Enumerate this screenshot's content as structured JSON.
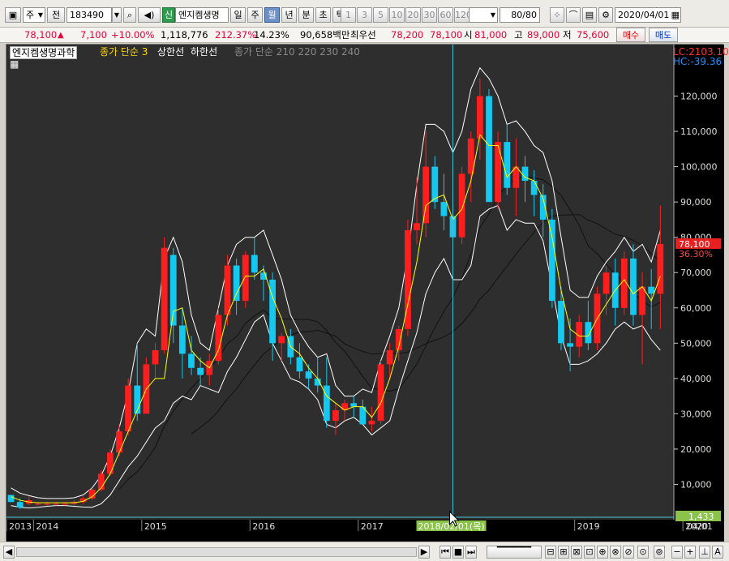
{
  "toolbar": {
    "period_code": "주",
    "prev_label": "전",
    "stock_code": "183490",
    "badge_new": "신",
    "stock_name": "엔지켐생명",
    "period_tabs": [
      "일",
      "주",
      "월",
      "년",
      "분",
      "초",
      "틱"
    ],
    "active_period": "월",
    "number_tabs": [
      "1",
      "3",
      "5",
      "10",
      "20",
      "30",
      "60",
      "120"
    ],
    "count_display": "80/80",
    "date_value": "2020/04/01"
  },
  "quote": {
    "price": "78,100",
    "change_arrow": "▲",
    "change": "7,100",
    "change_pct": "+10.00%",
    "volume": "1,118,776",
    "vol_ratio": "212.37%",
    "turnover": "14.23%",
    "amount": "90,658백만",
    "min_quote_label": "최우선",
    "best_ask": "78,200",
    "best_bid": "78,100",
    "open_label": "시",
    "open": "81,000",
    "high_label": "고",
    "high": "89,000",
    "low_label": "저",
    "low": "75,600",
    "buy_label": "매수",
    "sell_label": "매도"
  },
  "legend": {
    "name": "엔지켐생명과학",
    "ma_label": "종가 단순 3",
    "upper_label": "상한선",
    "lower_label": "하한선",
    "ma_long_label": "종가 단순 210 220 230 240"
  },
  "readouts": {
    "lc": "LC:2103.10",
    "hc": "HC:-39.36",
    "last_price": "78,100",
    "last_pct": "36.30%",
    "cursor_value": "1,433",
    "cursor_date": "2018/02/01(목)",
    "x_end": "04/01"
  },
  "colors": {
    "up": "#ff1e1e",
    "down": "#14c8f0",
    "ma": "#ffff00",
    "band": "#ffffff",
    "long_ma": "#000000",
    "cursor": "#47c3d9"
  },
  "chart_data": {
    "type": "candlestick",
    "interval": "monthly",
    "ylim": [
      0,
      130000
    ],
    "y_ticks": [
      10000,
      20000,
      30000,
      40000,
      50000,
      60000,
      70000,
      80000,
      90000,
      100000,
      110000,
      120000
    ],
    "y_tick_labels": [
      "10,000",
      "20,000",
      "30,000",
      "40,000",
      "50,000",
      "60,000",
      "70,000",
      "80,000",
      "90,000",
      "100,000",
      "110,000",
      "120,000"
    ],
    "x_year_labels": [
      "2013",
      "2014",
      "2015",
      "2016",
      "2017",
      "2019",
      "2020"
    ],
    "x_year_start_index": [
      0,
      3,
      15,
      27,
      39,
      63,
      75
    ],
    "candles": [
      [
        7000,
        7000,
        5000,
        5000
      ],
      [
        5000,
        6000,
        3000,
        3500
      ],
      [
        4500,
        6500,
        4000,
        5500
      ],
      [
        4500,
        5000,
        4000,
        4500
      ],
      [
        4500,
        5000,
        4000,
        4500
      ],
      [
        4500,
        5000,
        4000,
        4500
      ],
      [
        4500,
        5000,
        4000,
        4500
      ],
      [
        4500,
        5500,
        4000,
        5000
      ],
      [
        5000,
        6500,
        4500,
        6000
      ],
      [
        6000,
        9000,
        5500,
        8500
      ],
      [
        8500,
        14000,
        8000,
        13000
      ],
      [
        13000,
        20000,
        12500,
        19000
      ],
      [
        19000,
        27000,
        18000,
        25000
      ],
      [
        25000,
        40000,
        24000,
        38000
      ],
      [
        38000,
        50000,
        28000,
        30000
      ],
      [
        30000,
        46000,
        30000,
        44000
      ],
      [
        44000,
        50000,
        40000,
        48000
      ],
      [
        48000,
        80000,
        47000,
        77000
      ],
      [
        75000,
        77000,
        50000,
        55000
      ],
      [
        55000,
        60000,
        40000,
        47000
      ],
      [
        47000,
        52000,
        41000,
        43000
      ],
      [
        43000,
        46000,
        38000,
        41000
      ],
      [
        41000,
        47000,
        38000,
        45000
      ],
      [
        45000,
        60000,
        44000,
        58000
      ],
      [
        58000,
        75000,
        55000,
        72000
      ],
      [
        72000,
        74000,
        58000,
        62000
      ],
      [
        62000,
        76000,
        60000,
        75000
      ],
      [
        75000,
        80000,
        68000,
        70000
      ],
      [
        70000,
        72000,
        62000,
        68000
      ],
      [
        68000,
        70000,
        45000,
        50000
      ],
      [
        50000,
        53000,
        45000,
        52000
      ],
      [
        52000,
        54000,
        44000,
        46000
      ],
      [
        46000,
        50000,
        40000,
        42000
      ],
      [
        42000,
        44000,
        37000,
        40000
      ],
      [
        40000,
        46000,
        36000,
        38000
      ],
      [
        38000,
        46000,
        26000,
        28000
      ],
      [
        28000,
        33000,
        24000,
        31000
      ],
      [
        31000,
        34000,
        28000,
        33000
      ],
      [
        33000,
        35000,
        29000,
        32000
      ],
      [
        32000,
        34000,
        27000,
        27000
      ],
      [
        27000,
        32000,
        25000,
        28000
      ],
      [
        28000,
        45000,
        27000,
        44000
      ],
      [
        44000,
        50000,
        40000,
        48000
      ],
      [
        48000,
        55000,
        45000,
        54000
      ],
      [
        54000,
        85000,
        52000,
        82000
      ],
      [
        82000,
        97000,
        78000,
        84000
      ],
      [
        84000,
        110000,
        80000,
        100000
      ],
      [
        100000,
        103000,
        88000,
        90000
      ],
      [
        90000,
        98000,
        82000,
        86000
      ],
      [
        86000,
        90000,
        78000,
        80000
      ],
      [
        80000,
        100000,
        78000,
        98000
      ],
      [
        98000,
        110000,
        90000,
        108000
      ],
      [
        108000,
        125000,
        102000,
        120000
      ],
      [
        120000,
        122000,
        95000,
        90000
      ],
      [
        90000,
        110000,
        88000,
        107000
      ],
      [
        107000,
        112000,
        92000,
        94000
      ],
      [
        94000,
        108000,
        86000,
        100000
      ],
      [
        100000,
        103000,
        90000,
        96000
      ],
      [
        96000,
        99000,
        86000,
        92000
      ],
      [
        92000,
        95000,
        80000,
        85000
      ],
      [
        85000,
        88000,
        60000,
        62000
      ],
      [
        62000,
        66000,
        48000,
        50000
      ],
      [
        50000,
        57000,
        42000,
        49000
      ],
      [
        49000,
        58000,
        46000,
        56000
      ],
      [
        56000,
        62000,
        48000,
        50000
      ],
      [
        50000,
        66000,
        48000,
        64000
      ],
      [
        64000,
        72000,
        58000,
        70000
      ],
      [
        70000,
        74000,
        55000,
        60000
      ],
      [
        60000,
        76000,
        58000,
        74000
      ],
      [
        74000,
        78000,
        55000,
        58000
      ],
      [
        58000,
        70000,
        44000,
        66000
      ],
      [
        66000,
        71000,
        54000,
        64000
      ],
      [
        64000,
        89000,
        54000,
        78100
      ]
    ],
    "ma3": [
      6500,
      5500,
      5000,
      4800,
      4800,
      4800,
      4800,
      4800,
      5200,
      6500,
      9000,
      13000,
      19000,
      25000,
      31000,
      37000,
      40000,
      40000,
      59000,
      60000,
      48000,
      45000,
      43000,
      48000,
      58000,
      64000,
      69000,
      69000,
      71000,
      63000,
      57000,
      49000,
      47000,
      43000,
      40000,
      35000,
      33000,
      31000,
      32000,
      32000,
      29000,
      33000,
      40000,
      49000,
      61000,
      73000,
      89000,
      91000,
      92000,
      85000,
      88000,
      96000,
      109000,
      106000,
      106000,
      97000,
      100000,
      97000,
      96000,
      91000,
      80000,
      65000,
      54000,
      52000,
      52000,
      57000,
      61000,
      65000,
      68000,
      64000,
      66000,
      62000,
      69000
    ],
    "band_upper": [
      9000,
      7500,
      6800,
      6200,
      6000,
      6000,
      6000,
      6200,
      7000,
      9000,
      12500,
      18000,
      26000,
      36000,
      50000,
      54000,
      52000,
      74000,
      80000,
      73000,
      58000,
      50000,
      48000,
      60000,
      72000,
      78000,
      80000,
      80000,
      82000,
      75000,
      68000,
      58000,
      53000,
      49000,
      46000,
      47000,
      38000,
      35000,
      35000,
      37000,
      36000,
      45000,
      52000,
      60000,
      75000,
      95000,
      112000,
      112000,
      110000,
      104000,
      110000,
      122000,
      128000,
      125000,
      120000,
      112000,
      113000,
      110000,
      106000,
      104000,
      96000,
      80000,
      65000,
      63000,
      63000,
      69000,
      73000,
      76000,
      80000,
      76000,
      78000,
      73000,
      82000
    ],
    "band_lower": [
      4000,
      3500,
      3300,
      3500,
      3800,
      4000,
      4000,
      3800,
      3600,
      3500,
      4500,
      7000,
      11000,
      15000,
      18000,
      22000,
      26000,
      28000,
      33000,
      35000,
      34000,
      38000,
      37000,
      36000,
      42000,
      46000,
      51000,
      56000,
      58000,
      50000,
      45000,
      40000,
      39000,
      37000,
      34000,
      27000,
      26000,
      28000,
      29000,
      27000,
      24000,
      26000,
      28000,
      37000,
      45000,
      53000,
      64000,
      70000,
      74000,
      68000,
      68000,
      72000,
      86000,
      88000,
      89000,
      82000,
      85000,
      84000,
      84000,
      79000,
      66000,
      52000,
      44000,
      44000,
      45000,
      47000,
      50000,
      54000,
      56000,
      54000,
      55000,
      51000,
      48000
    ]
  }
}
